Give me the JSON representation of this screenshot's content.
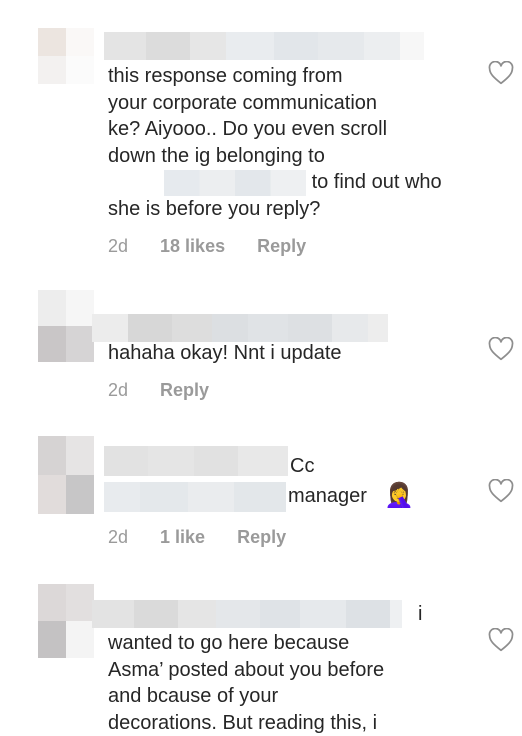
{
  "comments": [
    {
      "text_lines": [
        "this response coming from",
        "your corporate communication",
        "ke? Aiyooo.. Do you even scroll",
        "down the ig belonging to"
      ],
      "text_after_blur": "to find out who",
      "text_last": "she is before you reply?",
      "time": "2d",
      "likes": "18 likes",
      "reply": "Reply"
    },
    {
      "text": "hahaha okay! Nnt i update",
      "time": "2d",
      "reply": "Reply"
    },
    {
      "text_line1": "Cc",
      "text_line2": "manager",
      "emoji": "🤦‍♀️",
      "time": "2d",
      "likes": "1 like",
      "reply": "Reply"
    },
    {
      "text_line1_suffix": "i",
      "text_lines": [
        "wanted to go here because",
        "Asma’ posted about you before",
        "and bcause of your",
        "decorations. But reading this, i"
      ]
    }
  ],
  "icons": {
    "like": "heart-outline-icon"
  },
  "colors": {
    "text": "#262626",
    "meta": "#9a9a9a",
    "heart_stroke": "#8e8e8e"
  }
}
